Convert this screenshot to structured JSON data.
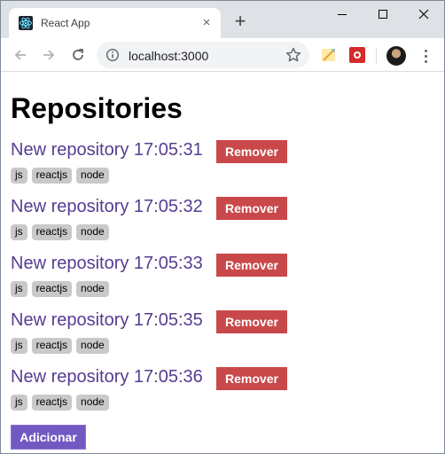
{
  "browser": {
    "tab_title": "React App",
    "tab_close_glyph": "×",
    "new_tab_glyph": "+",
    "url": "localhost:3000",
    "icons": {
      "favicon": "react-icon",
      "back": "arrow-left-icon",
      "forward": "arrow-right-icon",
      "reload": "reload-icon",
      "info": "info-icon",
      "bookmark": "star-icon",
      "extension_1": "notes-extension-icon",
      "extension_2": "red-extension-icon",
      "menu": "kebab-menu-icon"
    },
    "colors": {
      "tabstrip": "#dee1e6",
      "omnibox": "#f1f3f4"
    }
  },
  "page": {
    "heading": "Repositories",
    "remove_label": "Remover",
    "add_label": "Adicionar",
    "repositories": [
      {
        "title": "New repository 17:05:31",
        "techs": [
          "js",
          "reactjs",
          "node"
        ]
      },
      {
        "title": "New repository 17:05:32",
        "techs": [
          "js",
          "reactjs",
          "node"
        ]
      },
      {
        "title": "New repository 17:05:33",
        "techs": [
          "js",
          "reactjs",
          "node"
        ]
      },
      {
        "title": "New repository 17:05:35",
        "techs": [
          "js",
          "reactjs",
          "node"
        ]
      },
      {
        "title": "New repository 17:05:36",
        "techs": [
          "js",
          "reactjs",
          "node"
        ]
      }
    ],
    "colors": {
      "title": "#563d91",
      "remove_button": "#c9494a",
      "add_button": "#7159c1",
      "tech_badge": "#c9c9c9"
    }
  }
}
